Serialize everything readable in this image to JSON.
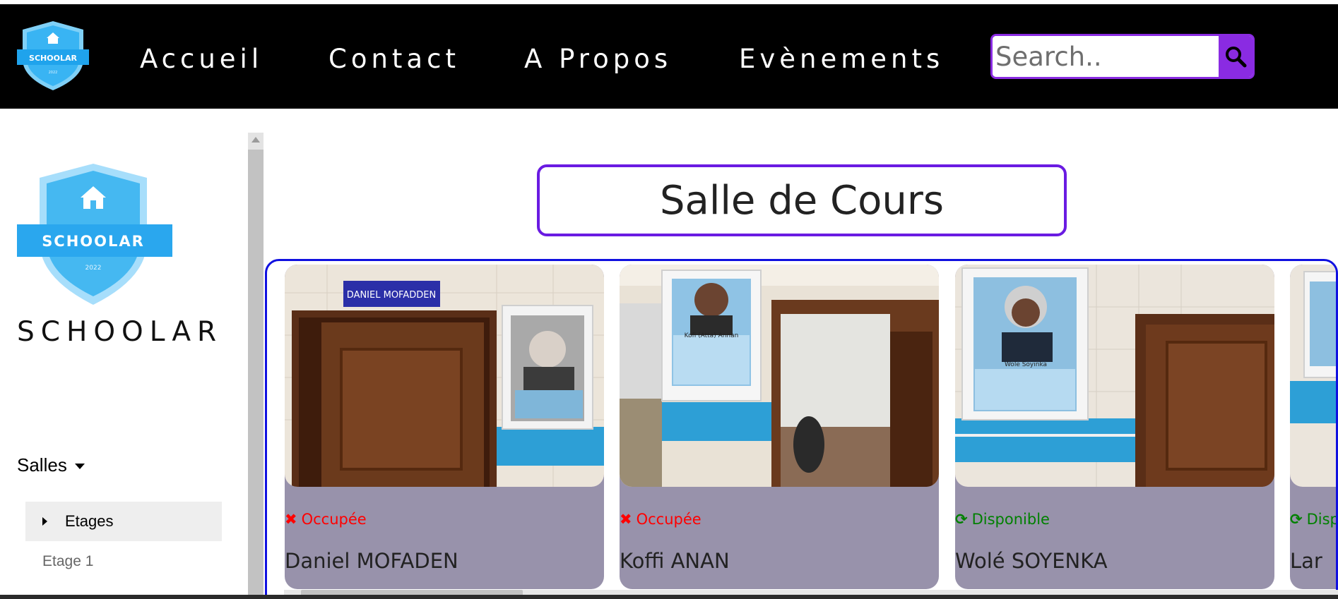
{
  "nav": {
    "links": [
      "Accueil",
      "Contact",
      "A Propos",
      "Evènements"
    ],
    "search_placeholder": "Search.."
  },
  "logo": {
    "badge_text": "SCHOOLAR",
    "year": "2022"
  },
  "sidebar": {
    "brand": "SCHOOLAR",
    "salles_label": "Salles",
    "etages_label": "Etages",
    "etage_item": "Etage 1"
  },
  "main": {
    "title": "Salle de Cours"
  },
  "cards": [
    {
      "status": "Occupée",
      "status_color": "#ff0000",
      "status_icon": "x-icon",
      "name": "Daniel MOFADEN",
      "plaque": "DANIEL MOFADDEN"
    },
    {
      "status": "Occupée",
      "status_color": "#ff0000",
      "status_icon": "x-icon",
      "name": "Koffi ANAN",
      "plaque": "Kofi (Atta) Annan"
    },
    {
      "status": "Disponible",
      "status_color": "#008000",
      "status_icon": "refresh-icon",
      "name": "Wolé SOYENKA",
      "plaque": "Wole Soyinka"
    },
    {
      "status": "Disponible",
      "status_color": "#008000",
      "status_icon": "refresh-icon",
      "name": "Lar",
      "plaque": ""
    }
  ],
  "colors": {
    "accent": "#8a2be2",
    "title_border": "#6a1be2",
    "cards_border": "#1010e0",
    "card_bg": "#9892ab"
  }
}
